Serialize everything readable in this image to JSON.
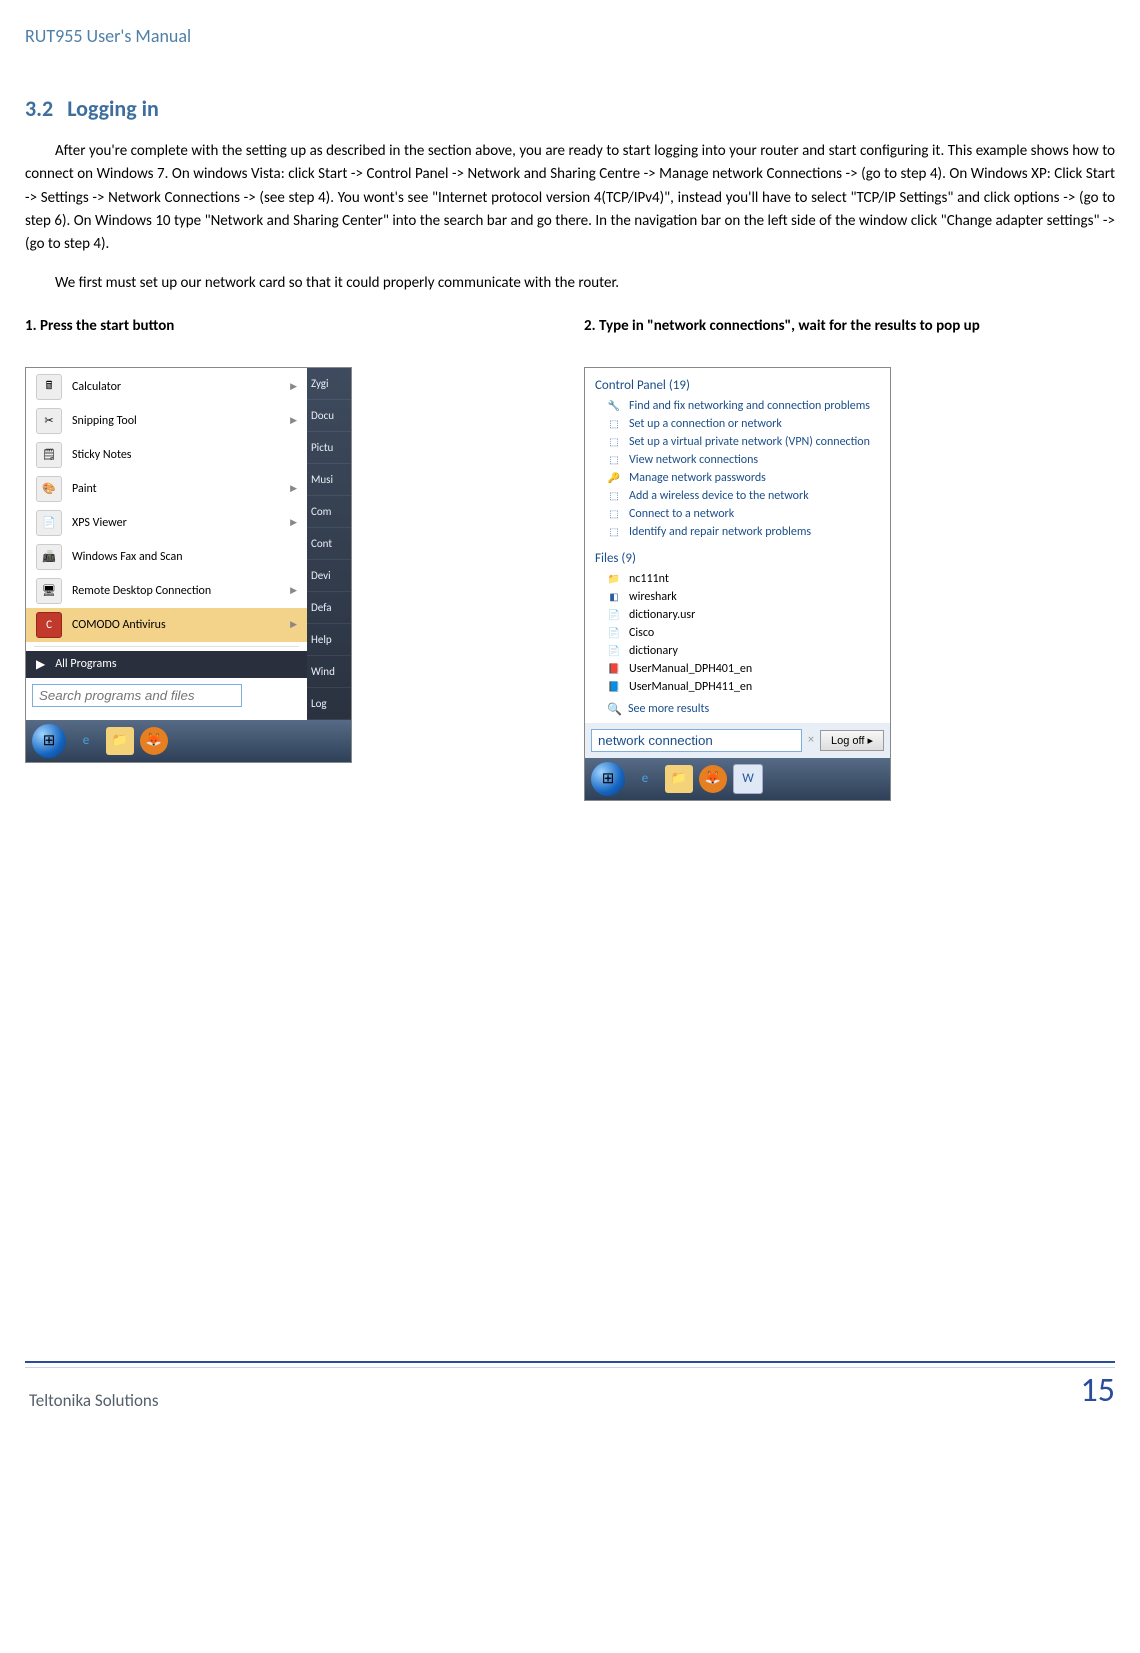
{
  "doc_header": "RUT955 User's Manual",
  "section": {
    "number": "3.2",
    "title": "Logging in"
  },
  "paragraphs": {
    "p1": "After you're complete with the setting up as described in the section above, you are ready to start logging into your router and start configuring it. This example shows how to connect on Windows 7. On windows Vista: click Start -> Control Panel -> Network and Sharing Centre -> Manage network Connections -> (go to step 4). On Windows XP: Click Start -> Settings -> Network Connections -> (see step 4). You wont's see \"Internet protocol version 4(TCP/IPv4)\", instead you'll have to select \"TCP/IP Settings\" and click options -> (go to step 6). On Windows 10 type \"Network and Sharing Center\" into the search bar and go there. In the navigation bar on the left side of the window click \"Change adapter settings\" -> (go to step 4).",
    "p2": "We first must set up our network card so that it could properly communicate with the router."
  },
  "steps": {
    "s1": "1. Press the start button",
    "s2": "2. Type in \"network connections\", wait for the results to pop up"
  },
  "startmenu": {
    "items": [
      "Calculator",
      "Snipping Tool",
      "Sticky Notes",
      "Paint",
      "XPS Viewer",
      "Windows Fax and Scan",
      "Remote Desktop Connection",
      "COMODO Antivirus"
    ],
    "all_programs": "All Programs",
    "search_placeholder": "Search programs and files",
    "right_items": [
      "Zygi",
      "Docu",
      "Pictu",
      "Musi",
      "Com",
      "Cont",
      "Devi",
      "Defa",
      "Help",
      "Wind",
      "Log"
    ]
  },
  "results": {
    "head1": "Control Panel (19)",
    "cp": [
      "Find and fix networking and connection problems",
      "Set up a connection or network",
      "Set up a virtual private network (VPN) connection",
      "View network connections",
      "Manage network passwords",
      "Add a wireless device to the network",
      "Connect to a network",
      "Identify and repair network problems"
    ],
    "head2": "Files (9)",
    "files": [
      "nc111nt",
      "wireshark",
      "dictionary.usr",
      "Cisco",
      "dictionary",
      "UserManual_DPH401_en",
      "UserManual_DPH411_en"
    ],
    "more": "See more results",
    "input_value": "network connection",
    "logoff": "Log off"
  },
  "footer": {
    "left": "Teltonika Solutions",
    "page": "15"
  }
}
